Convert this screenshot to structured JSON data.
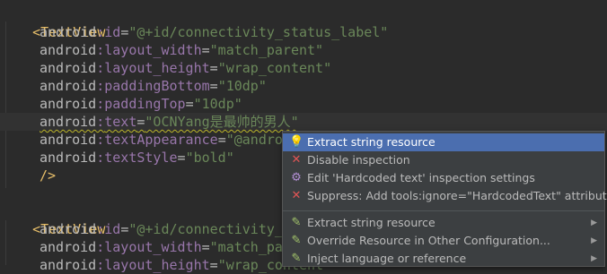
{
  "code": {
    "block1": {
      "open_tag": "<TextView",
      "attrs": [
        {
          "ns": "android",
          "name": "id",
          "value": "\"@+id/connectivity_status_label\""
        },
        {
          "ns": "android",
          "name": "layout_width",
          "value": "\"match_parent\""
        },
        {
          "ns": "android",
          "name": "layout_height",
          "value": "\"wrap_content\""
        },
        {
          "ns": "android",
          "name": "paddingBottom",
          "value": "\"10dp\""
        },
        {
          "ns": "android",
          "name": "paddingTop",
          "value": "\"10dp\""
        },
        {
          "ns": "android",
          "name": "text",
          "value": "\"OCNYang是最帅的男人\""
        },
        {
          "ns": "android",
          "name": "textAppearance",
          "value": "\"@android:style/TextAppearance.Medium\""
        },
        {
          "ns": "android",
          "name": "textStyle",
          "value": "\"bold\""
        }
      ],
      "close": "/>"
    },
    "block2": {
      "open_tag": "<TextView",
      "attrs": [
        {
          "ns": "android",
          "name": "id",
          "value": "\"@+id/connectivity_status_detail\""
        },
        {
          "ns": "android",
          "name": "layout_width",
          "value": "\"match_parent\""
        },
        {
          "ns": "android",
          "name": "layout_height",
          "value": "\"wrap_content\""
        }
      ]
    },
    "colon": ":",
    "equals": "="
  },
  "popup": {
    "items": [
      {
        "label": "Extract string resource",
        "icon": "lightbulb-icon"
      },
      {
        "label": "Disable inspection",
        "icon": "red-x-icon"
      },
      {
        "label": "Edit 'Hardcoded text' inspection settings",
        "icon": "gear-icon"
      },
      {
        "label": "Suppress: Add tools:ignore=\"HardcodedText\" attribute",
        "icon": "red-x-icon"
      },
      {
        "label": "Extract string resource",
        "icon": "pencil-icon"
      },
      {
        "label": "Override Resource in Other Configuration...",
        "icon": "pencil-icon"
      },
      {
        "label": "Inject language or reference",
        "icon": "pencil-icon"
      }
    ],
    "arrow_glyph": "▶"
  },
  "colors": {
    "background": "#2b2b2b",
    "tag": "#e8bf6a",
    "namespace": "#9876aa",
    "string": "#6a8759",
    "popup_bg": "#3c3f41",
    "selection": "#4b6eaf"
  }
}
